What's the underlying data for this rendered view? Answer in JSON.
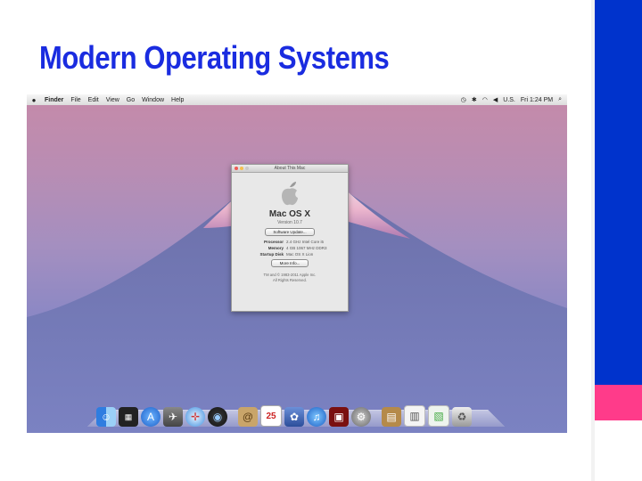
{
  "slide": {
    "title": "Modern Operating Systems",
    "colors": {
      "title": "#1a2ce0",
      "side_blue": "#0033cc",
      "side_pink": "#ff3b8a"
    }
  },
  "menubar": {
    "apple_icon": "apple-icon",
    "items": [
      "Finder",
      "File",
      "Edit",
      "View",
      "Go",
      "Window",
      "Help"
    ],
    "status": {
      "clock": "Fri 1:24 PM",
      "language": "U.S."
    }
  },
  "about_window": {
    "title": "About This Mac",
    "os_name": "Mac OS X",
    "version": "Version 10.7",
    "software_update_label": "Software Update...",
    "rows": [
      {
        "key": "Processor",
        "value": "2.4 GHz Intel Core i5"
      },
      {
        "key": "Memory",
        "value": "4 GB 1067 MHz DDR3"
      },
      {
        "key": "Startup Disk",
        "value": "Mac OS X Lion"
      }
    ],
    "more_info_label": "More Info...",
    "footer_line1": "TM and © 1983-2011 Apple Inc.",
    "footer_line2": "All Rights Reserved."
  },
  "dock": {
    "apps": [
      "finder",
      "dashboard",
      "app-store",
      "launchpad",
      "safari",
      "facetime",
      "address-book",
      "ical",
      "iphoto",
      "itunes",
      "photo-booth",
      "system-preferences",
      "downloads",
      "documents",
      "applications",
      "trash"
    ]
  }
}
